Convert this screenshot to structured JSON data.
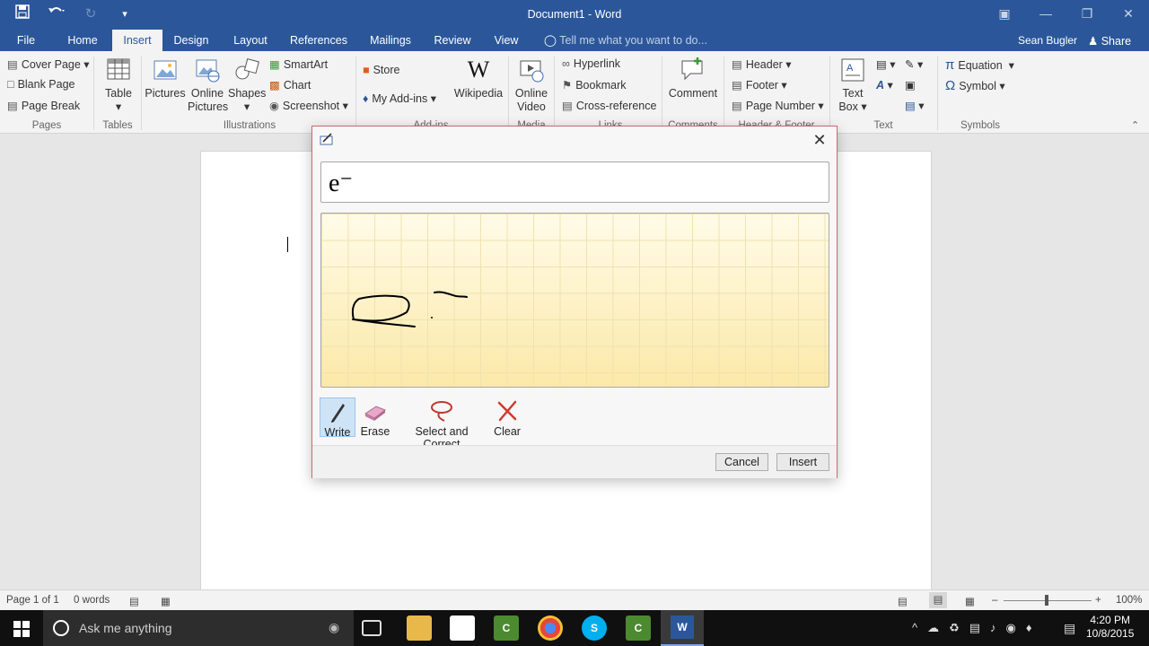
{
  "window": {
    "title": "Document1 - Word"
  },
  "quick_access": {
    "save_icon": "save-icon",
    "undo_icon": "undo-icon",
    "redo_icon": "redo-icon",
    "customize_icon": "customize-qat-icon"
  },
  "tabs": [
    {
      "label": "File"
    },
    {
      "label": "Home"
    },
    {
      "label": "Insert",
      "active": true
    },
    {
      "label": "Design"
    },
    {
      "label": "Layout"
    },
    {
      "label": "References"
    },
    {
      "label": "Mailings"
    },
    {
      "label": "Review"
    },
    {
      "label": "View"
    }
  ],
  "tell_me": "Tell me what you want to do...",
  "user": "Sean Bugler",
  "share": "Share",
  "ribbon": {
    "pages": {
      "cover": "Cover Page",
      "blank": "Blank Page",
      "break": "Page Break",
      "group": "Pages"
    },
    "tables": {
      "table": "Table",
      "group": "Tables"
    },
    "illustrations": {
      "pictures": "Pictures",
      "online_pictures_1": "Online",
      "online_pictures_2": "Pictures",
      "shapes": "Shapes",
      "smartart": "SmartArt",
      "chart": "Chart",
      "screenshot": "Screenshot",
      "group": "Illustrations"
    },
    "addins": {
      "store": "Store",
      "myaddins": "My Add-ins",
      "wikipedia": "Wikipedia",
      "group": "Add-ins"
    },
    "media": {
      "online_video_1": "Online",
      "online_video_2": "Video",
      "group": "Media"
    },
    "links": {
      "hyperlink": "Hyperlink",
      "bookmark": "Bookmark",
      "crossref": "Cross-reference",
      "group": "Links"
    },
    "comments": {
      "comment": "Comment",
      "group": "Comments"
    },
    "header_footer": {
      "header": "Header",
      "footer": "Footer",
      "page_number": "Page Number",
      "group": "Header & Footer"
    },
    "text": {
      "textbox_1": "Text",
      "textbox_2": "Box",
      "group": "Text"
    },
    "symbols": {
      "equation": "Equation",
      "symbol": "Symbol",
      "group": "Symbols"
    }
  },
  "dialog": {
    "preview": "e⁻",
    "tools": [
      {
        "label": "Write",
        "icon": "pen-icon",
        "selected": true
      },
      {
        "label": "Erase",
        "icon": "eraser-icon"
      },
      {
        "label": "Select and Correct",
        "icon": "lasso-icon"
      },
      {
        "label": "Clear",
        "icon": "clear-icon"
      }
    ],
    "cancel": "Cancel",
    "insert": "Insert"
  },
  "status": {
    "page": "Page 1 of 1",
    "words": "0 words",
    "zoom": "100%"
  },
  "taskbar": {
    "search": "Ask me anything",
    "time": "4:20 PM",
    "date": "10/8/2015"
  },
  "colors": {
    "word_blue": "#2b579a",
    "ink_bg": "#fdf4d2"
  }
}
